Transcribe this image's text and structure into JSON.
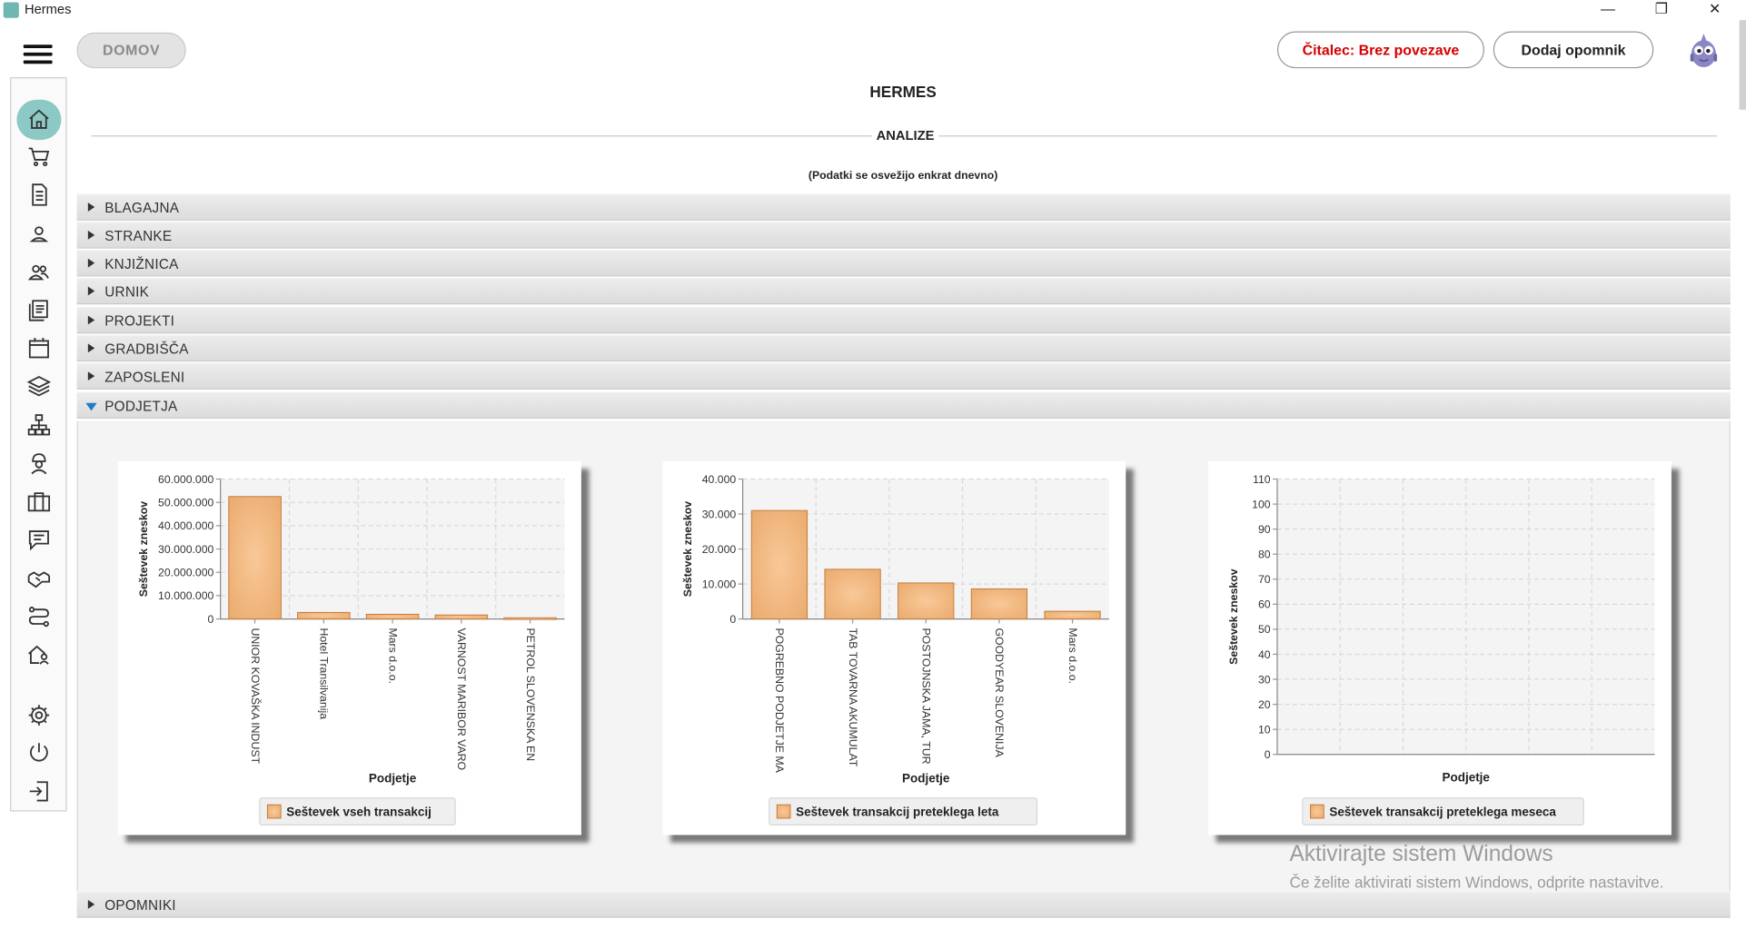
{
  "window": {
    "title": "Hermes",
    "controls": [
      "—",
      "❐",
      "✕"
    ]
  },
  "topbar": {
    "home_button": "DOMOV",
    "reader_button": "Čitalec: Brez povezave",
    "reminder_button": "Dodaj opomnik"
  },
  "sidebar": {
    "icons": [
      "home-icon",
      "cart-icon",
      "document-icon",
      "person-icon",
      "people-icon",
      "list-icon",
      "calendar-icon",
      "layers-icon",
      "network-icon",
      "worker-icon",
      "briefcase-icon",
      "chat-icon",
      "handshake-icon",
      "route-icon",
      "house-person-icon",
      "gear-icon",
      "power-icon",
      "logout-icon"
    ]
  },
  "page": {
    "title": "HERMES",
    "section": "ANALIZE",
    "note": "(Podatki se osvežijo enkrat dnevno)"
  },
  "accordion": [
    {
      "label": "BLAGAJNA",
      "open": false
    },
    {
      "label": "STRANKE",
      "open": false
    },
    {
      "label": "KNJIŽNICA",
      "open": false
    },
    {
      "label": "URNIK",
      "open": false
    },
    {
      "label": "PROJEKTI",
      "open": false
    },
    {
      "label": "GRADBIŠČA",
      "open": false
    },
    {
      "label": "ZAPOSLENI",
      "open": false
    },
    {
      "label": "PODJETJA",
      "open": true
    },
    {
      "label": "OPOMNIKI",
      "open": false
    }
  ],
  "colors": {
    "accent": "#8cc9c4",
    "bar": "#e9a86a",
    "bar_edge": "#c47c3d",
    "error_text": "#d40000"
  },
  "chart_data": [
    {
      "type": "bar",
      "categories": [
        "UNIOR KOVAŠKA INDUST",
        "Hotel Transilvanija",
        "Mars d.o.o.",
        "VARNOST MARIBOR VARO",
        "PETROL SLOVENSKA EN"
      ],
      "values": [
        52500000,
        2800000,
        2000000,
        1700000,
        500000
      ],
      "ylim": [
        0,
        60000000
      ],
      "yticks": [
        "0",
        "10.000.000",
        "20.000.000",
        "30.000.000",
        "40.000.000",
        "50.000.000",
        "60.000.000"
      ],
      "xlabel": "Podjetje",
      "ylabel": "Seštevek zneskov",
      "legend": "Seštevek vseh transakcij",
      "grid": true
    },
    {
      "type": "bar",
      "categories": [
        "POGREBNO PODJETJE MA",
        "TAB TOVARNA AKUMULAT",
        "POSTOJNSKA JAMA, TUR",
        "GOODYEAR SLOVENIJA",
        "Mars d.o.o."
      ],
      "values": [
        31000,
        14200,
        10300,
        8600,
        2200
      ],
      "ylim": [
        0,
        40000
      ],
      "yticks": [
        "0",
        "10.000",
        "20.000",
        "30.000",
        "40.000"
      ],
      "xlabel": "Podjetje",
      "ylabel": "Seštevek zneskov",
      "legend": "Seštevek transakcij preteklega leta",
      "grid": true
    },
    {
      "type": "bar",
      "categories": [],
      "values": [],
      "ylim": [
        0,
        110
      ],
      "yticks": [
        "0",
        "10",
        "20",
        "30",
        "40",
        "50",
        "60",
        "70",
        "80",
        "90",
        "100",
        "110"
      ],
      "xlabel": "Podjetje",
      "ylabel": "Seštevek zneskov",
      "legend": "Seštevek transakcij preteklega meseca",
      "grid": true
    }
  ],
  "watermark": {
    "line1": "Aktivirajte sistem Windows",
    "line2": "Če želite aktivirati sistem Windows, odprite nastavitve."
  }
}
